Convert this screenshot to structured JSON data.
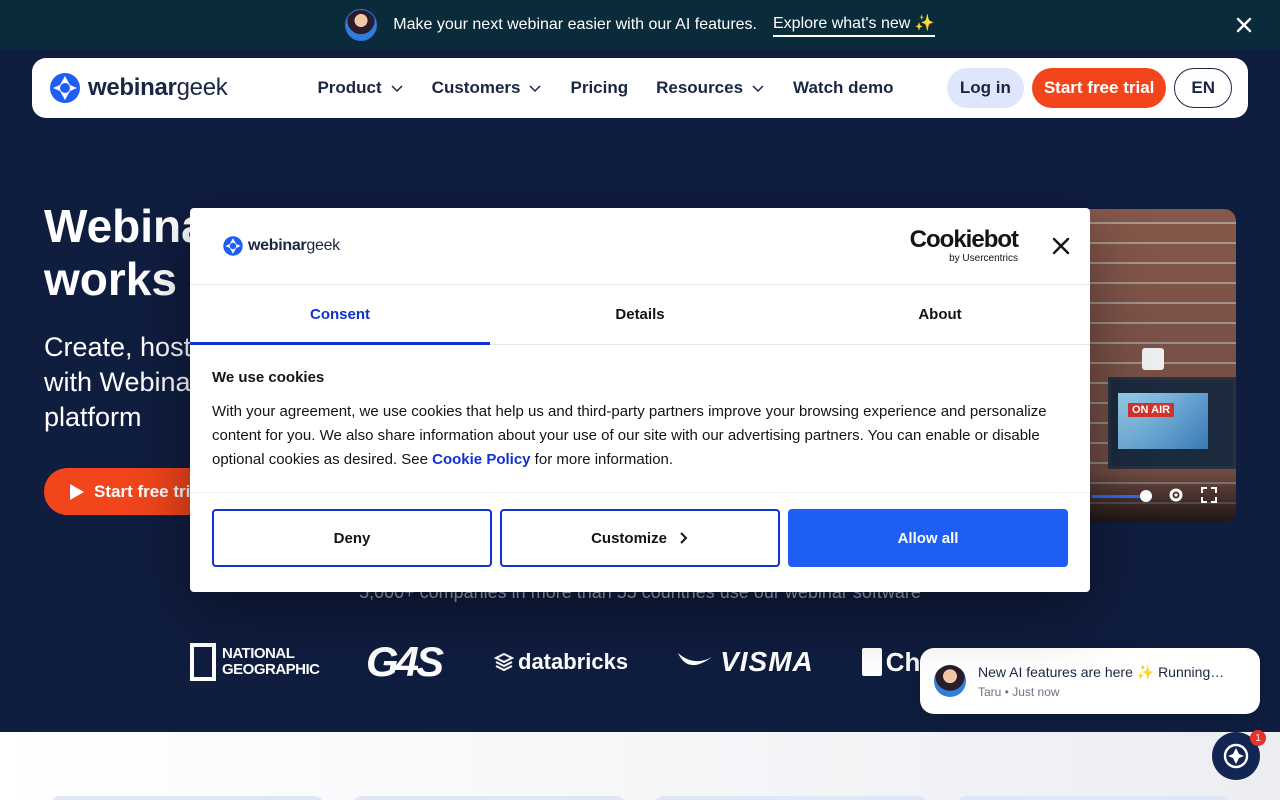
{
  "announcement": {
    "message": "Make your next webinar easier with our AI features.",
    "link": "Explore what's new ✨"
  },
  "nav": {
    "logo_bold": "webinar",
    "logo_light": "geek",
    "items": [
      {
        "label": "Product",
        "dropdown": true
      },
      {
        "label": "Customers",
        "dropdown": true
      },
      {
        "label": "Pricing",
        "dropdown": false
      },
      {
        "label": "Resources",
        "dropdown": true
      },
      {
        "label": "Watch demo",
        "dropdown": false
      }
    ],
    "login": "Log in",
    "trial": "Start free trial",
    "lang": "EN"
  },
  "hero": {
    "title_line1": "Webina",
    "title_line2": "works f",
    "subtitle_line1": "Create, host",
    "subtitle_line2": "with Webinar",
    "subtitle_line3": "platform",
    "cta": "Start free tri",
    "video_sign": "ON AIR"
  },
  "companies": {
    "text": "5,000+ companies in more than 55 countries use our webinar software",
    "natgeo": "NATIONAL GEOGRAPHIC",
    "g4s": "G4S",
    "databricks": "databricks",
    "visma": "VISMA",
    "chartlo": "Chartlo"
  },
  "chat": {
    "message": "New AI features are here ✨ Running…",
    "meta": "Taru • Just now",
    "badge": "1"
  },
  "cookie_modal": {
    "brand_bold": "webinar",
    "brand_light": "geek",
    "cookiebot": "Cookiebot",
    "cookiebot_by": "by Usercentrics",
    "tabs": [
      "Consent",
      "Details",
      "About"
    ],
    "active_tab": "Consent",
    "heading": "We use cookies",
    "body_before": "With your agreement, we use cookies that help us and third-party partners improve your browsing experience and personalize content for you. We also share information about your use of our site with our advertising partners. You can enable or disable optional cookies as desired. See ",
    "policy_link": "Cookie Policy",
    "body_after": " for more information.",
    "deny": "Deny",
    "customize": "Customize",
    "allow_all": "Allow all"
  },
  "colors": {
    "background": "#0f1d3f",
    "announcement": "#0a2b3a",
    "accent_orange": "#f2451c",
    "modal_blue": "#1f5ef4",
    "tab_blue": "#1032cf"
  },
  "icons": {
    "close": "close-icon",
    "chevron": "chevron-down-icon",
    "play": "play-icon",
    "settings": "gear-icon",
    "fullscreen": "fullscreen-icon",
    "chat": "chat-icon",
    "arrow": "chevron-right-icon"
  }
}
